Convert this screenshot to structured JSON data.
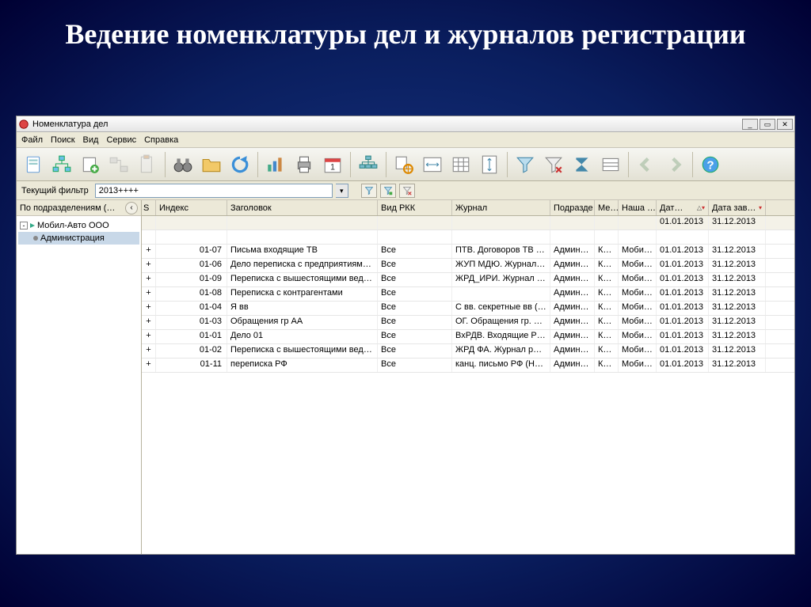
{
  "slideTitle": "Ведение номенклатуры дел и журналов регистрации",
  "window": {
    "title": "Номенклатура дел"
  },
  "menu": {
    "file": "Файл",
    "search": "Поиск",
    "view": "Вид",
    "service": "Сервис",
    "help": "Справка"
  },
  "filter": {
    "label": "Текущий фильтр",
    "value": "2013++++"
  },
  "sidebar": {
    "header": "По подразделениям (…",
    "root": "Мобил-Авто ООО",
    "child": "Администрация"
  },
  "columns": {
    "s": "S",
    "index": "Индекс",
    "title": "Заголовок",
    "kind": "Вид РКК",
    "journal": "Журнал",
    "dept": "Подразде…",
    "me": "Ме…",
    "our": "Наша …",
    "date1": "Дат…",
    "date2": "Дата зав…"
  },
  "topRow": {
    "date1": "01.01.2013",
    "date2": "31.12.2013"
  },
  "rows": [
    {
      "s": "+",
      "index": "01-07",
      "title": "Письма входящие ТВ",
      "kind": "Все",
      "journal": "ПТВ. Договоров ТВ (Н…",
      "dept": "Админист…",
      "me": "Ка…",
      "our": "Мобил…",
      "date1": "01.01.2013",
      "date2": "31.12.2013"
    },
    {
      "s": "+",
      "index": "01-06",
      "title": "Дело переписка с предприятиями М…",
      "kind": "Все",
      "journal": "ЖУП МДЮ. Журнал у…",
      "dept": "Админист…",
      "me": "Ка…",
      "our": "Мобил…",
      "date1": "01.01.2013",
      "date2": "31.12.2013"
    },
    {
      "s": "+",
      "index": "01-09",
      "title": "Переписка с вышестоящими ведомс…",
      "kind": "Все",
      "journal": "ЖРД_ИРИ. Журнал ре…",
      "dept": "Админист…",
      "me": "Ка…",
      "our": "Мобил…",
      "date1": "01.01.2013",
      "date2": "31.12.2013"
    },
    {
      "s": "+",
      "index": "01-08",
      "title": "Переписка с контрагентами",
      "kind": "Все",
      "journal": "",
      "dept": "Админист…",
      "me": "Ка…",
      "our": "Мобил…",
      "date1": "01.01.2013",
      "date2": "31.12.2013"
    },
    {
      "s": "+",
      "index": "01-04",
      "title": "Я вв",
      "kind": "Все",
      "journal": "С вв. секретные вв (…",
      "dept": "Админист…",
      "me": "Ка…",
      "our": "Мобил…",
      "date1": "01.01.2013",
      "date2": "31.12.2013"
    },
    {
      "s": "+",
      "index": "01-03",
      "title": "Обращения гр АА",
      "kind": "Все",
      "journal": "ОГ. Обращения гр. А…",
      "dept": "Админист…",
      "me": "Ка…",
      "our": "Мобил…",
      "date1": "01.01.2013",
      "date2": "31.12.2013"
    },
    {
      "s": "+",
      "index": "01-01",
      "title": "Дело 01",
      "kind": "Все",
      "journal": "ВхРДВ. Входящие РВД…",
      "dept": "Админист…",
      "me": "Ка…",
      "our": "Мобил…",
      "date1": "01.01.2013",
      "date2": "31.12.2013"
    },
    {
      "s": "+",
      "index": "01-02",
      "title": "Переписка с вышестоящими ведомс…",
      "kind": "Все",
      "journal": "ЖРД ФА. Журнал рег…",
      "dept": "Админист…",
      "me": "Ка…",
      "our": "Мобил…",
      "date1": "01.01.2013",
      "date2": "31.12.2013"
    },
    {
      "s": "+",
      "index": "01-11",
      "title": "переписка РФ",
      "kind": "Все",
      "journal": "канц. письмо РФ (НДО…",
      "dept": "Админист…",
      "me": "Ка…",
      "our": "Мобил…",
      "date1": "01.01.2013",
      "date2": "31.12.2013"
    }
  ]
}
